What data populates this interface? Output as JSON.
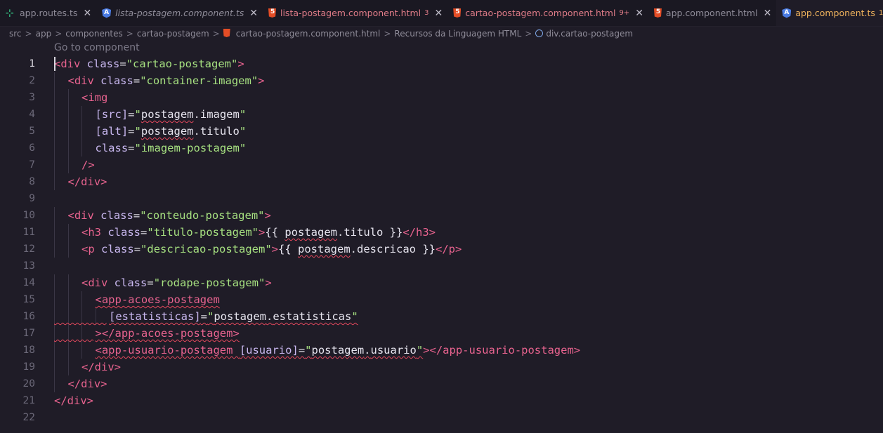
{
  "tabs": [
    {
      "label": "app.routes.ts",
      "icon": "ts-icon",
      "badge": "",
      "state": "normal"
    },
    {
      "label": "lista-postagem.component.ts",
      "icon": "angular-icon",
      "badge": "",
      "state": "italic"
    },
    {
      "label": "lista-postagem.component.html",
      "icon": "html-icon",
      "badge": "3",
      "state": "modified"
    },
    {
      "label": "cartao-postagem.component.html",
      "icon": "html-icon",
      "badge": "9+",
      "state": "modified"
    },
    {
      "label": "app.component.html",
      "icon": "html-icon",
      "badge": "",
      "state": "normal"
    },
    {
      "label": "app.component.ts",
      "icon": "angular-icon",
      "badge": "1",
      "state": "active"
    }
  ],
  "tab_close_glyph": "✕",
  "breadcrumb": {
    "separator": ">",
    "items": [
      "src",
      "app",
      "componentes",
      "cartao-postagem",
      "cartao-postagem.component.html",
      "Recursos da Linguagem HTML",
      "div.cartao-postagem"
    ]
  },
  "codelens": "Go to component",
  "code_lines": [
    {
      "n": "1",
      "indent": 0,
      "tokens": [
        [
          "tag",
          "<div"
        ],
        [
          "p",
          " "
        ],
        [
          "attr",
          "class"
        ],
        [
          "p",
          "="
        ],
        [
          "str",
          "\"cartao-postagem\""
        ],
        [
          "tag",
          ">"
        ]
      ]
    },
    {
      "n": "2",
      "indent": 1,
      "tokens": [
        [
          "tag",
          "<div"
        ],
        [
          "p",
          " "
        ],
        [
          "attr",
          "class"
        ],
        [
          "p",
          "="
        ],
        [
          "str",
          "\"container-imagem\""
        ],
        [
          "tag",
          ">"
        ]
      ]
    },
    {
      "n": "3",
      "indent": 2,
      "tokens": [
        [
          "tag",
          "<img"
        ]
      ]
    },
    {
      "n": "4",
      "indent": 3,
      "tokens": [
        [
          "attr",
          "[src]"
        ],
        [
          "p",
          "="
        ],
        [
          "str",
          "\""
        ],
        [
          "expr",
          "postagem",
          "err"
        ],
        [
          "p",
          "."
        ],
        [
          "expr",
          "imagem"
        ],
        [
          "str",
          "\""
        ]
      ]
    },
    {
      "n": "5",
      "indent": 3,
      "tokens": [
        [
          "attr",
          "[alt]"
        ],
        [
          "p",
          "="
        ],
        [
          "str",
          "\""
        ],
        [
          "expr",
          "postagem",
          "err"
        ],
        [
          "p",
          "."
        ],
        [
          "expr",
          "titulo"
        ],
        [
          "str",
          "\""
        ]
      ]
    },
    {
      "n": "6",
      "indent": 3,
      "tokens": [
        [
          "attr",
          "class"
        ],
        [
          "p",
          "="
        ],
        [
          "str",
          "\"imagem-postagem\""
        ]
      ]
    },
    {
      "n": "7",
      "indent": 2,
      "tokens": [
        [
          "tag",
          "/>"
        ]
      ]
    },
    {
      "n": "8",
      "indent": 1,
      "tokens": [
        [
          "tag",
          "</div>"
        ]
      ]
    },
    {
      "n": "9",
      "indent": 0,
      "tokens": []
    },
    {
      "n": "10",
      "indent": 1,
      "tokens": [
        [
          "tag",
          "<div"
        ],
        [
          "p",
          " "
        ],
        [
          "attr",
          "class"
        ],
        [
          "p",
          "="
        ],
        [
          "str",
          "\"conteudo-postagem\""
        ],
        [
          "tag",
          ">"
        ]
      ]
    },
    {
      "n": "11",
      "indent": 2,
      "tokens": [
        [
          "tag",
          "<h3"
        ],
        [
          "p",
          " "
        ],
        [
          "attr",
          "class"
        ],
        [
          "p",
          "="
        ],
        [
          "str",
          "\"titulo-postagem\""
        ],
        [
          "tag",
          ">"
        ],
        [
          "expr",
          "{{ "
        ],
        [
          "expr",
          "postagem",
          "err"
        ],
        [
          "p",
          "."
        ],
        [
          "expr",
          "titulo }}"
        ],
        [
          "tag",
          "</h3>"
        ]
      ]
    },
    {
      "n": "12",
      "indent": 2,
      "tokens": [
        [
          "tag",
          "<p"
        ],
        [
          "p",
          " "
        ],
        [
          "attr",
          "class"
        ],
        [
          "p",
          "="
        ],
        [
          "str",
          "\"descricao-postagem\""
        ],
        [
          "tag",
          ">"
        ],
        [
          "expr",
          "{{ "
        ],
        [
          "expr",
          "postagem",
          "err"
        ],
        [
          "p",
          "."
        ],
        [
          "expr",
          "descricao }}"
        ],
        [
          "tag",
          "</p>"
        ]
      ]
    },
    {
      "n": "13",
      "indent": 0,
      "tokens": []
    },
    {
      "n": "14",
      "indent": 2,
      "tokens": [
        [
          "tag",
          "<div"
        ],
        [
          "p",
          " "
        ],
        [
          "attr",
          "class"
        ],
        [
          "p",
          "="
        ],
        [
          "str",
          "\"rodape-postagem\""
        ],
        [
          "tag",
          ">"
        ]
      ]
    },
    {
      "n": "15",
      "indent": 3,
      "tokens": [
        [
          "tag",
          "<app-acoes-postagem",
          "err"
        ]
      ]
    },
    {
      "n": "16",
      "indent": 4,
      "errlead": true,
      "tokens": [
        [
          "attr",
          "[estatisticas]",
          "err"
        ],
        [
          "p",
          "=",
          "err"
        ],
        [
          "str",
          "\"",
          "err"
        ],
        [
          "expr",
          "postagem",
          "err"
        ],
        [
          "p",
          ".",
          "err"
        ],
        [
          "expr",
          "estatisticas",
          "err"
        ],
        [
          "str",
          "\"",
          "err"
        ]
      ]
    },
    {
      "n": "17",
      "indent": 3,
      "errlead": true,
      "tokens": [
        [
          "tag",
          "></app-acoes-postagem>",
          "err"
        ]
      ]
    },
    {
      "n": "18",
      "indent": 3,
      "tokens": [
        [
          "tag",
          "<app-usuario-postagem",
          "err"
        ],
        [
          "p",
          " ",
          "err"
        ],
        [
          "attr",
          "[usuario]",
          "err"
        ],
        [
          "p",
          "=",
          "err"
        ],
        [
          "str",
          "\"",
          "err"
        ],
        [
          "expr",
          "postagem",
          "err"
        ],
        [
          "p",
          ".",
          "err"
        ],
        [
          "expr",
          "usuario",
          "err"
        ],
        [
          "str",
          "\"",
          "err"
        ],
        [
          "tag",
          "></app-usuario-postagem>"
        ]
      ]
    },
    {
      "n": "19",
      "indent": 2,
      "tokens": [
        [
          "tag",
          "</div>"
        ]
      ]
    },
    {
      "n": "20",
      "indent": 1,
      "tokens": [
        [
          "tag",
          "</div>"
        ]
      ]
    },
    {
      "n": "21",
      "indent": 0,
      "tokens": [
        [
          "tag",
          "</div>"
        ]
      ]
    },
    {
      "n": "22",
      "indent": 0,
      "tokens": []
    }
  ],
  "current_line": "1"
}
